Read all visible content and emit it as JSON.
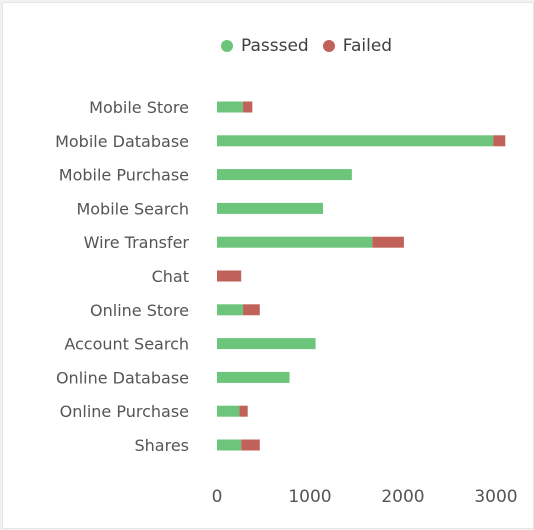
{
  "chart_data": {
    "type": "bar",
    "orientation": "horizontal",
    "stacked": true,
    "categories": [
      "Mobile Store",
      "Mobile Database",
      "Mobile Purchase",
      "Mobile Search",
      "Wire Transfer",
      "Chat",
      "Online Store",
      "Account Search",
      "Online Database",
      "Online Purchase",
      "Shares"
    ],
    "series": [
      {
        "name": "Passsed",
        "color": "#6cc57a",
        "values": [
          280,
          2970,
          1450,
          1140,
          1670,
          0,
          280,
          1060,
          780,
          240,
          260
        ]
      },
      {
        "name": "Failed",
        "color": "#c0625a",
        "values": [
          100,
          130,
          0,
          0,
          340,
          260,
          180,
          0,
          0,
          90,
          200
        ]
      }
    ],
    "xlim": [
      0,
      3200
    ],
    "xticks": [
      "0",
      "1000",
      "2000",
      "3000"
    ],
    "legend": "top",
    "grid": false
  }
}
